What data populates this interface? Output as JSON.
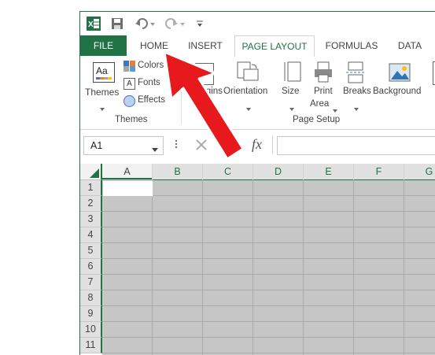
{
  "qat": {
    "app_icon": "excel-logo-icon",
    "app_letter": "X"
  },
  "tabs": [
    {
      "label": "FILE"
    },
    {
      "label": "HOME"
    },
    {
      "label": "INSERT"
    },
    {
      "label": "PAGE LAYOUT"
    },
    {
      "label": "FORMULAS"
    },
    {
      "label": "DATA"
    }
  ],
  "ribbon": {
    "themes": {
      "label": "Themes",
      "colors": "Colors",
      "fonts": "Fonts",
      "effects": "Effects",
      "group": "Themes",
      "icon_text": "Aa"
    },
    "page_setup": {
      "margins": "Margins",
      "orientation": "Orientation",
      "size": "Size",
      "print_area_1": "Print",
      "print_area_2": "Area",
      "breaks": "Breaks",
      "background": "Background",
      "group": "Page Setup"
    }
  },
  "formula_bar": {
    "name_box": "A1",
    "fx": "fx"
  },
  "grid": {
    "columns": [
      "A",
      "B",
      "C",
      "D",
      "E",
      "F",
      "G"
    ],
    "rows": [
      "1",
      "2",
      "3",
      "4",
      "5",
      "6",
      "7",
      "8",
      "9",
      "10",
      "11"
    ]
  },
  "colors": {
    "accent": "#217346",
    "arrow": "#e8191c",
    "cell_fill": "#c6c6c6"
  }
}
